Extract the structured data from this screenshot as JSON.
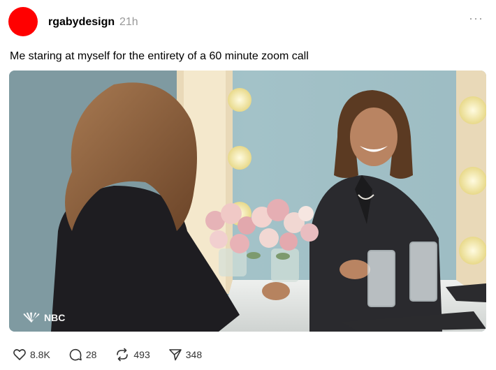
{
  "post": {
    "username": "rgabydesign",
    "timestamp": "21h",
    "caption": "Me staring at myself for the entirety of a 60 minute zoom call",
    "more_label": "···",
    "avatar_color": "#ff0000",
    "watermark": "NBC"
  },
  "actions": {
    "like_count": "8.8K",
    "comment_count": "28",
    "repost_count": "493",
    "share_count": "348"
  },
  "colors": {
    "text": "#000000",
    "muted": "#999999",
    "icon": "#333333"
  }
}
